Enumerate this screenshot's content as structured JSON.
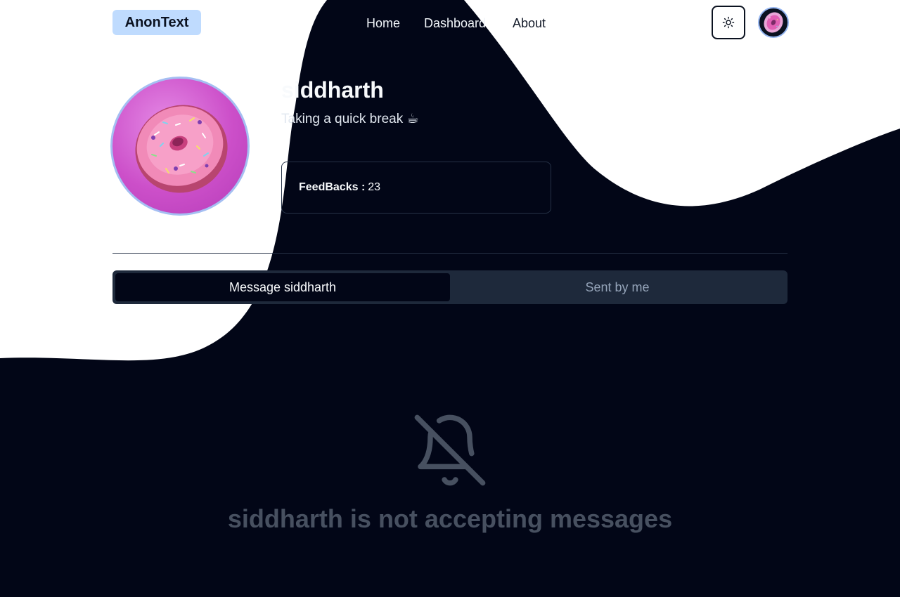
{
  "brand": {
    "name": "AnonText"
  },
  "nav": {
    "links": [
      {
        "label": "Home"
      },
      {
        "label": "Dashboard"
      },
      {
        "label": "About"
      }
    ],
    "theme_toggle_icon": "sun-icon",
    "user_avatar": "donut-avatar"
  },
  "profile": {
    "username": "siddharth",
    "status": "Taking a quick break ☕",
    "feedbacks": {
      "label": "FeedBacks :",
      "value": "23"
    },
    "avatar": "donut-avatar"
  },
  "tabs": [
    {
      "label": "Message siddharth",
      "active": true
    },
    {
      "label": "Sent by me",
      "active": false
    }
  ],
  "empty_state": {
    "icon": "bell-off-icon",
    "message": "siddharth is not accepting messages"
  },
  "colors": {
    "background_dark": "#020617",
    "brand_badge": "#bfdbfe",
    "tabs_bg": "#1e293b",
    "muted_text": "#475060"
  }
}
